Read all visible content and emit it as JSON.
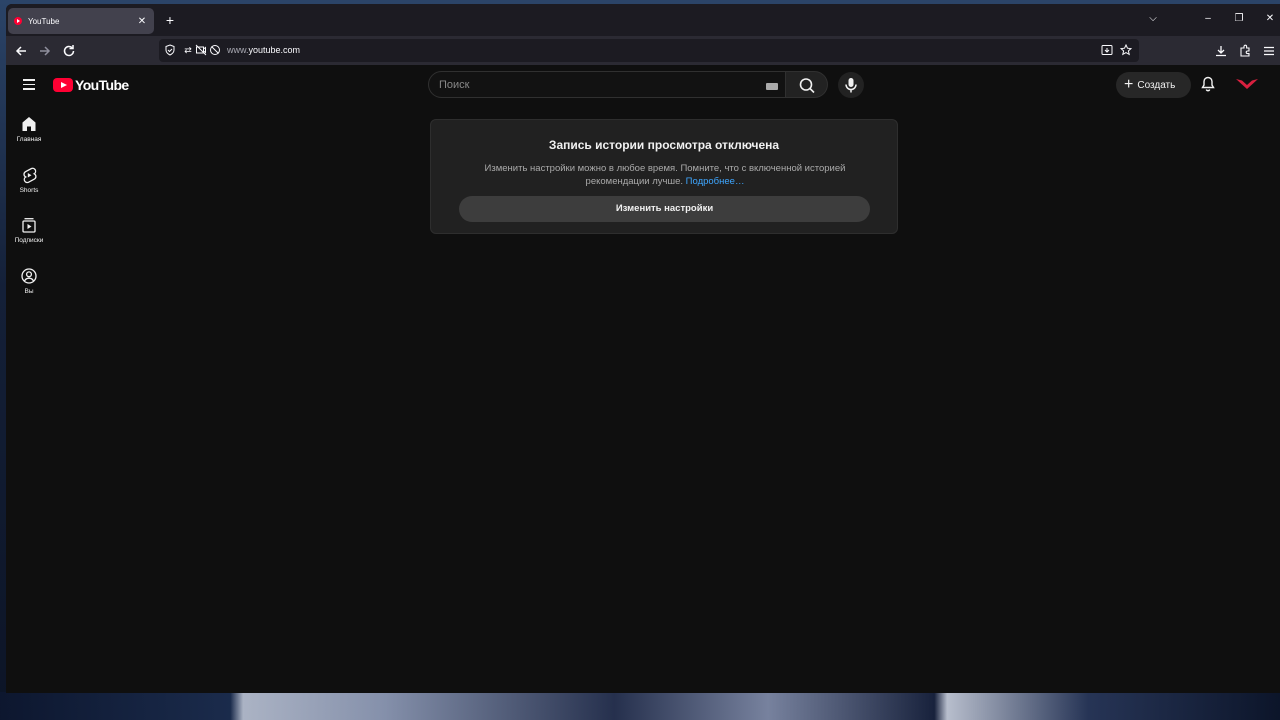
{
  "browser": {
    "tab": {
      "title": "YouTube",
      "close": "✕"
    },
    "new_tab": "+",
    "window_controls": {
      "list": "⌵",
      "minimize": "–",
      "restore": "❐",
      "close": "✕"
    },
    "url": {
      "prefix": "www.",
      "domain": "youtube.com"
    }
  },
  "youtube": {
    "logo_text": "YouTube",
    "search": {
      "placeholder": "Поиск"
    },
    "create_label": "Создать",
    "sidebar": [
      {
        "label": "Главная",
        "icon": "home-icon"
      },
      {
        "label": "Shorts",
        "icon": "shorts-icon"
      },
      {
        "label": "Подписки",
        "icon": "subscriptions-icon"
      },
      {
        "label": "Вы",
        "icon": "you-icon"
      }
    ],
    "notice": {
      "title": "Запись истории просмотра отключена",
      "text": "Изменить настройки можно в любое время. Помните, что с включенной историей рекомендации лучше.",
      "link": "Подробнее…",
      "button": "Изменить настройки"
    },
    "colors": {
      "brand": "#ff0033",
      "link": "#3ea6ff",
      "background": "#0f0f0f"
    }
  }
}
